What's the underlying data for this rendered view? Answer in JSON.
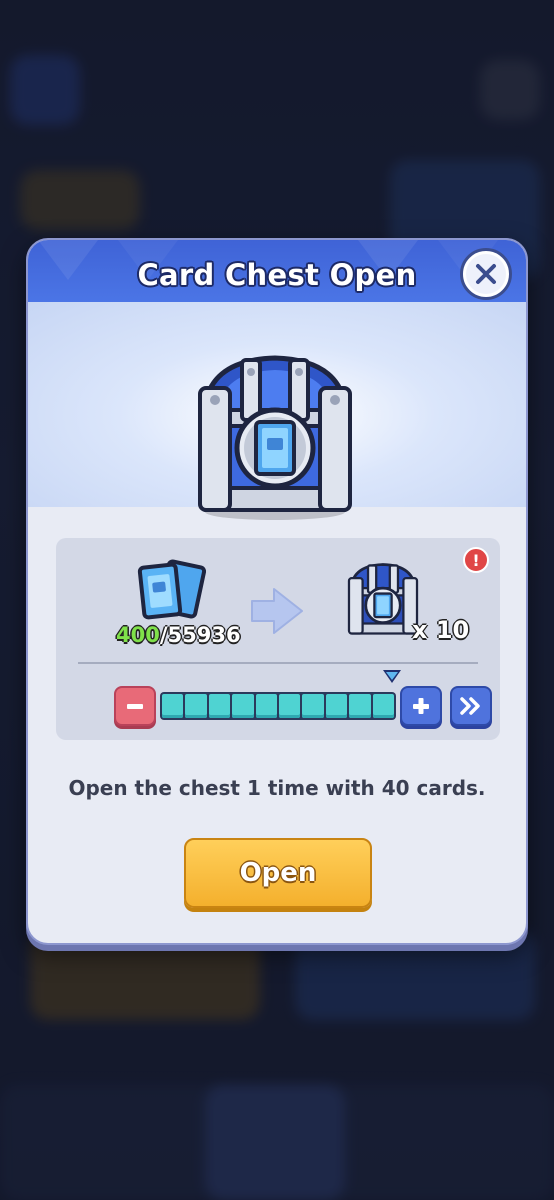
{
  "dialog": {
    "title": "Card Chest Open",
    "close_icon": "close-icon"
  },
  "exchange": {
    "cards_owned": "400",
    "cards_total_label": "/55936",
    "chest_multiplier": "x 10",
    "alert": "!"
  },
  "quantity": {
    "segments_filled": 10,
    "segments_total": 10,
    "minus_icon": "minus-icon",
    "plus_icon": "plus-icon",
    "max_icon": "double-chevron-right-icon"
  },
  "description": "Open the chest 1 time with 40 cards.",
  "actions": {
    "open_label": "Open"
  },
  "colors": {
    "header": "#4b75e6",
    "open_button": "#f4b02d",
    "bar_fill": "#4fd3d2",
    "owned_count": "#7fe04a"
  }
}
